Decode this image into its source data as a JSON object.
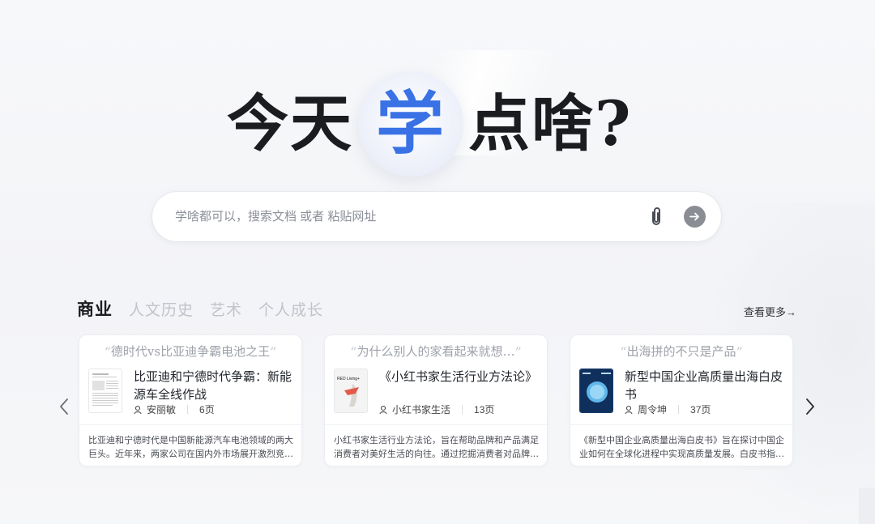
{
  "hero": {
    "part1": "今天",
    "highlight": "学",
    "part2": "点啥?"
  },
  "search": {
    "placeholder": "学啥都可以，搜索文档 或者 粘贴网址",
    "attach_icon": "paperclip-icon",
    "submit_icon": "arrow-right-icon"
  },
  "tabs": [
    {
      "label": "商业",
      "active": true
    },
    {
      "label": "人文历史",
      "active": false
    },
    {
      "label": "艺术",
      "active": false
    },
    {
      "label": "个人成长",
      "active": false
    }
  ],
  "more_link": "查看更多→",
  "cards": [
    {
      "quote": "德时代vs比亚迪争霸电池之王",
      "title": "比亚迪和宁德时代争霸：新能源车全线作战",
      "author": "安丽敏",
      "pages": "6页",
      "description": "比亚迪和宁德时代是中国新能源汽车电池领域的两大巨头。近年来，两家公司在国内外市场展开激烈竞…"
    },
    {
      "quote": "为什么别人的家看起来就想…",
      "title": "《小红书家生活行业方法论》",
      "author": "小红书家生活",
      "pages": "13页",
      "description": "小红书家生活行业方法论，旨在帮助品牌和产品满足消费者对美好生活的向往。通过挖掘消费者对品牌…",
      "thumb_text": "RED Living+"
    },
    {
      "quote": "出海拼的不只是产品",
      "title": "新型中国企业高质量出海白皮书",
      "author": "周令坤",
      "pages": "37页",
      "description": "《新型中国企业高质量出海白皮书》旨在探讨中国企业如何在全球化进程中实现高质量发展。白皮书指…"
    }
  ],
  "colors": {
    "accent": "#3a72e6",
    "submit_bg": "#8a8d93"
  }
}
